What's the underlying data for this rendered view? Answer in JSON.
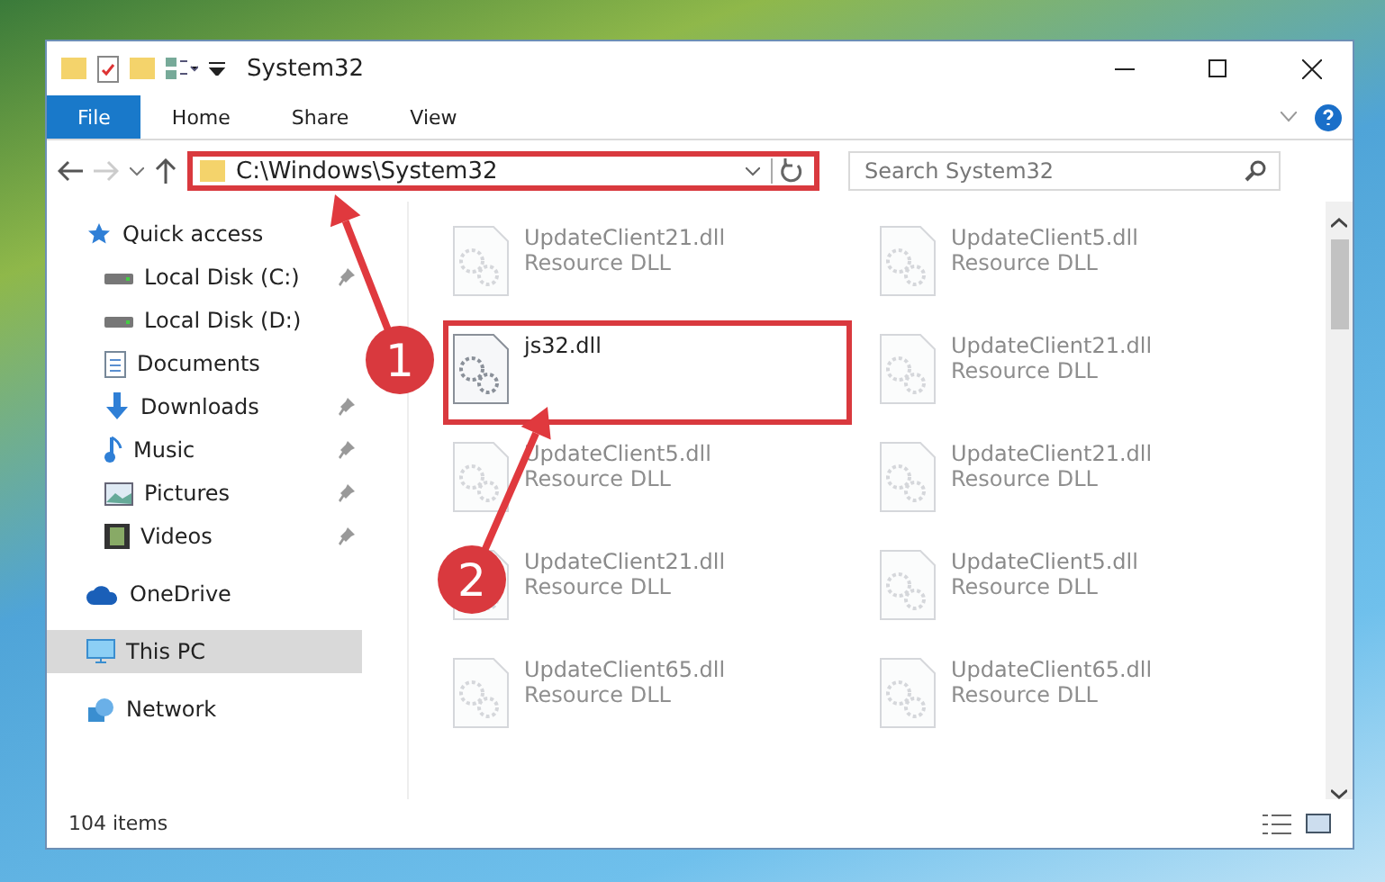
{
  "window": {
    "title": "System32"
  },
  "ribbon": {
    "tabs": [
      {
        "label": "File",
        "selected": true
      },
      {
        "label": "Home",
        "selected": false
      },
      {
        "label": "Share",
        "selected": false
      },
      {
        "label": "View",
        "selected": false
      }
    ]
  },
  "address_bar": {
    "path": "C:\\Windows\\System32",
    "highlighted": true
  },
  "search": {
    "placeholder": "Search System32"
  },
  "sidebar": {
    "items": [
      {
        "label": "Quick access",
        "kind": "star",
        "pinned": false,
        "selected": false,
        "children": [
          {
            "label": "Local Disk (C:)",
            "kind": "disk",
            "pinned": true,
            "selected": false
          },
          {
            "label": "Local Disk (D:)",
            "kind": "disk",
            "pinned": false,
            "selected": false
          },
          {
            "label": "Documents",
            "kind": "document",
            "pinned": false,
            "selected": false
          },
          {
            "label": "Downloads",
            "kind": "download",
            "pinned": true,
            "selected": false
          },
          {
            "label": "Music",
            "kind": "music",
            "pinned": true,
            "selected": false
          },
          {
            "label": "Pictures",
            "kind": "picture",
            "pinned": true,
            "selected": false
          },
          {
            "label": "Videos",
            "kind": "video",
            "pinned": true,
            "selected": false
          }
        ]
      },
      {
        "label": "OneDrive",
        "kind": "cloud",
        "pinned": false,
        "selected": false
      },
      {
        "label": "This PC",
        "kind": "pc",
        "pinned": false,
        "selected": true
      },
      {
        "label": "Network",
        "kind": "network",
        "pinned": false,
        "selected": false
      }
    ]
  },
  "files": [
    {
      "name": "UpdateClient21.dll",
      "type": "Resource DLL",
      "blurred": true,
      "highlighted": false
    },
    {
      "name": "UpdateClient5.dll",
      "type": "Resource DLL",
      "blurred": true,
      "highlighted": false
    },
    {
      "name": "js32.dll",
      "blurred": false,
      "highlighted": true
    },
    {
      "name": "UpdateClient21.dll",
      "type": "Resource DLL",
      "blurred": true,
      "highlighted": false
    },
    {
      "name": "UpdateClient5.dll",
      "type": "Resource DLL",
      "blurred": true,
      "highlighted": false
    },
    {
      "name": "UpdateClient21.dll",
      "type": "Resource DLL",
      "blurred": true,
      "highlighted": false
    },
    {
      "name": "UpdateClient21.dll",
      "type": "Resource DLL",
      "blurred": true,
      "highlighted": false
    },
    {
      "name": "UpdateClient5.dll",
      "type": "Resource DLL",
      "blurred": true,
      "highlighted": false
    },
    {
      "name": "UpdateClient65.dll",
      "type": "Resource DLL",
      "blurred": true,
      "highlighted": false
    },
    {
      "name": "UpdateClient65.dll",
      "type": "Resource DLL",
      "blurred": true,
      "highlighted": false
    }
  ],
  "status_bar": {
    "count": "104 items"
  },
  "callouts": [
    {
      "number": "1"
    },
    {
      "number": "2"
    }
  ]
}
